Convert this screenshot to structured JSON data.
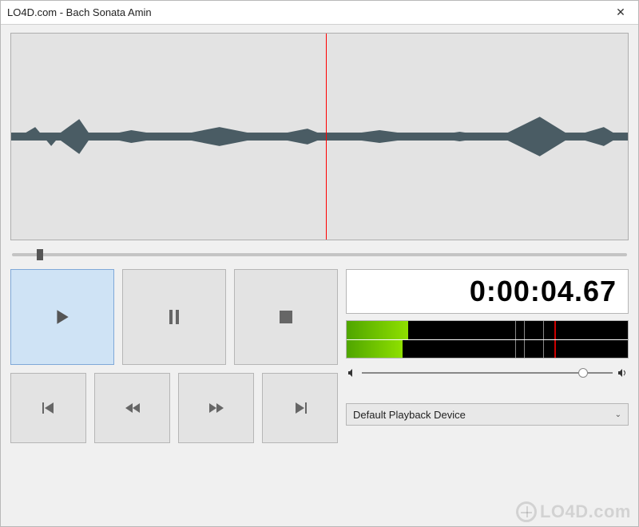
{
  "window": {
    "title": "LO4D.com - Bach Sonata Amin",
    "close_label": "✕"
  },
  "playback": {
    "playhead_percent": 51,
    "position_slider_percent": 4,
    "time_display": "0:00:04.67"
  },
  "buttons": {
    "play": "▶",
    "pause": "❚❚",
    "stop": "■",
    "prev": "|◀",
    "rewind": "◀◀",
    "forward": "▶▶",
    "next": "▶|"
  },
  "meter": {
    "left_percent": 22,
    "right_percent": 20,
    "ticks": [
      60,
      63,
      70
    ],
    "red_marks": [
      74
    ]
  },
  "volume": {
    "value_percent": 90
  },
  "device": {
    "selected": "Default Playback Device"
  },
  "watermark": {
    "text": "LO4D.com"
  }
}
